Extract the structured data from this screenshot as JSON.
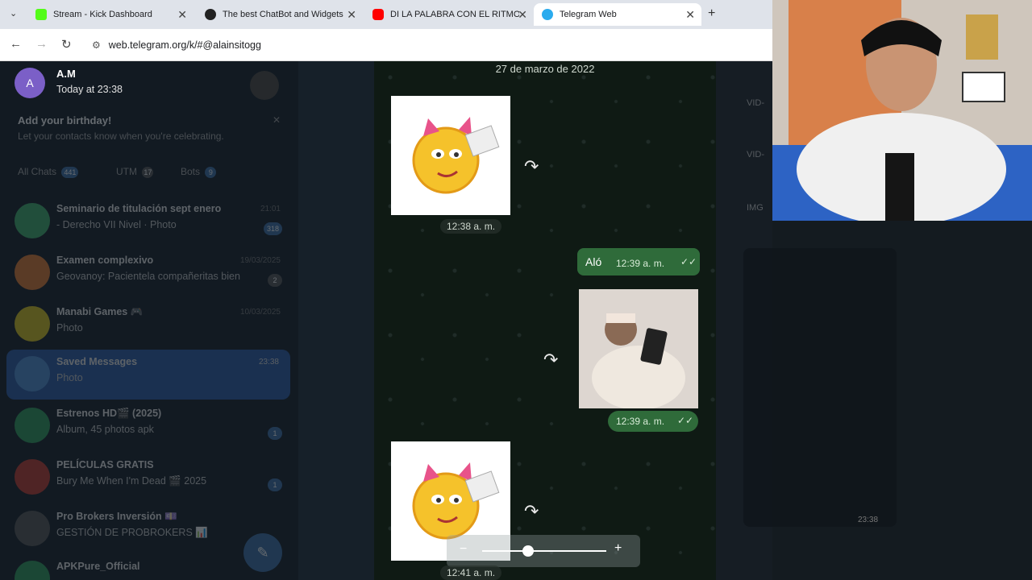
{
  "browser": {
    "tabs": [
      {
        "title": "Stream - Kick Dashboard",
        "active": false
      },
      {
        "title": "The best ChatBot and Widgets",
        "active": false
      },
      {
        "title": "DI LA PALABRA CON EL RITMO |",
        "active": false
      },
      {
        "title": "Telegram Web",
        "active": true
      }
    ],
    "url": "web.telegram.org/k/#@alainsitogg"
  },
  "viewer": {
    "sender_initial": "A",
    "sender_name": "A.M",
    "sender_time": "Today at 23:38",
    "date_header": "27 de marzo de 2022",
    "messages": [
      {
        "type": "sticker",
        "time": "12:38 a. m."
      },
      {
        "type": "text",
        "text": "Aló",
        "time": "12:39 a. m."
      },
      {
        "type": "photo",
        "time": "12:39 a. m."
      },
      {
        "type": "sticker",
        "time": "12:41 a. m."
      }
    ]
  },
  "sidebar": {
    "birthday_title": "Add your birthday!",
    "birthday_sub": "Let your contacts know when you're celebrating.",
    "folders": [
      {
        "label": "All Chats",
        "count": "441"
      },
      {
        "label": "UTM",
        "count": "17"
      },
      {
        "label": "Bots",
        "count": "9"
      }
    ],
    "chats": [
      {
        "name": "Seminario de titulación sept enero",
        "preview": "- Derecho VII Nivel · Photo",
        "date": "21:01",
        "badge": "318"
      },
      {
        "name": "Examen complexivo",
        "preview": "Geovanoy: Pacientela compañeritas bien",
        "date": "19/03/2025",
        "badge": "2"
      },
      {
        "name": "Manabi Games 🎮",
        "preview": "Photo",
        "date": "10/03/2025",
        "badge": ""
      },
      {
        "name": "Saved Messages",
        "preview": "Photo",
        "date": "23:38",
        "badge": ""
      },
      {
        "name": "Estrenos HD🎬 (2025)",
        "preview": "Album, 45 photos apk",
        "date": "",
        "badge": "1"
      },
      {
        "name": "PELÍCULAS GRATIS",
        "preview": "Bury Me When I'm Dead 🎬 2025",
        "date": "",
        "badge": "1"
      },
      {
        "name": "Pro Brokers Inversión 💷",
        "preview": "GESTIÓN DE PROBROKERS 📊",
        "date": "",
        "badge": ""
      },
      {
        "name": "APKPure_Official",
        "preview": "",
        "date": "",
        "badge": ""
      }
    ]
  },
  "right_panel": {
    "items": [
      "VID-",
      "VID-",
      "IMG"
    ],
    "time": "23:38"
  },
  "colors": {
    "accent": "#2f6b3a",
    "badge": "#3a6ea5",
    "tg_bg": "#111820"
  }
}
